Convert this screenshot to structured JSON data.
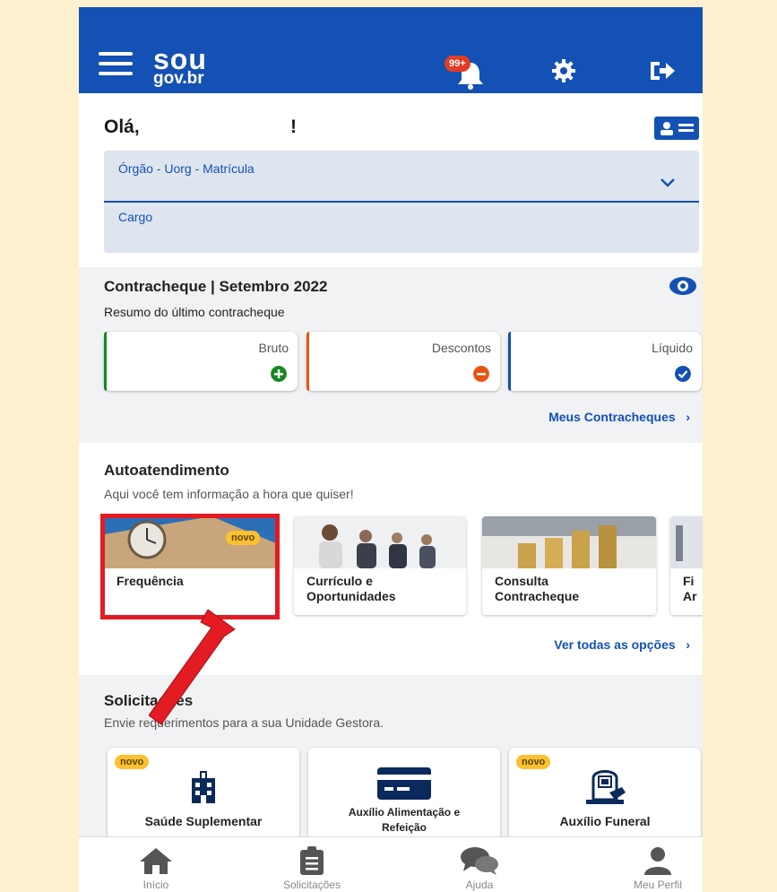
{
  "header": {
    "logo_top": "sou",
    "logo_bottom": "gov.br",
    "notif_badge": "99+"
  },
  "greeting": {
    "hello": "Olá,",
    "exclaim": "!"
  },
  "org": {
    "org_label": "Órgão - Uorg - Matrícula",
    "cargo_label": "Cargo"
  },
  "contracheque": {
    "title": "Contracheque | Setembro 2022",
    "subtitle": "Resumo do último contracheque",
    "cards": [
      {
        "label": "Bruto",
        "color": "#168821"
      },
      {
        "label": "Descontos",
        "color": "#e8540f"
      },
      {
        "label": "Líquido",
        "color": "#1351b4"
      }
    ],
    "link": "Meus Contracheques"
  },
  "autoatendimento": {
    "title": "Autoatendimento",
    "subtitle": "Aqui você tem informação a hora que quiser!",
    "items": [
      {
        "name": "Frequência",
        "badge": "novo"
      },
      {
        "name_line1": "Currículo e",
        "name_line2": "Oportunidades"
      },
      {
        "name_line1": "Consulta",
        "name_line2": "Contracheque"
      },
      {
        "name_line1": "Fi",
        "name_line2": "Ar"
      }
    ],
    "link": "Ver todas as opções"
  },
  "solicitacoes": {
    "title": "Solicitações",
    "subtitle": "Envie requerimentos para a sua Unidade Gestora.",
    "items": [
      {
        "name": "Saúde Suplementar",
        "badge": "novo"
      },
      {
        "name_line1": "Auxílio Alimentação e",
        "name_line2": "Refeição"
      },
      {
        "name": "Auxílio Funeral",
        "badge": "novo"
      }
    ]
  },
  "bottom_nav": {
    "items": [
      "Início",
      "Solicitações",
      "Ajuda",
      "Meu Perfil"
    ]
  },
  "colors": {
    "brand": "#1351b4",
    "highlight": "#e31b23",
    "badge": "#fdc02f"
  }
}
